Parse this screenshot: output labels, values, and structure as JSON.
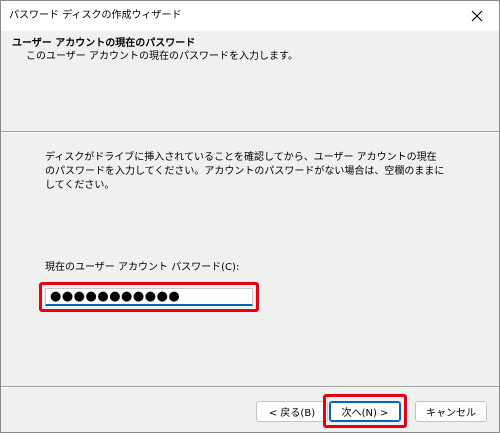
{
  "window": {
    "title": "パスワード ディスクの作成ウィザード"
  },
  "header": {
    "title": "ユーザー アカウントの現在のパスワード",
    "subtitle": "このユーザー アカウントの現在のパスワードを入力します。"
  },
  "body": {
    "description": "ディスクがドライブに挿入されていることを確認してから、ユーザー アカウントの現在のパスワードを入力してください。アカウントのパスワードがない場合は、空欄のままにしてください。",
    "password_label": "現在のユーザー アカウント パスワード(C):",
    "password_value": "●●●●●●●●●●●"
  },
  "buttons": {
    "back": "< 戻る(B)",
    "next": "次へ(N) >",
    "cancel": "キャンセル"
  },
  "colors": {
    "highlight": "#e60012",
    "accent": "#0067c0"
  }
}
